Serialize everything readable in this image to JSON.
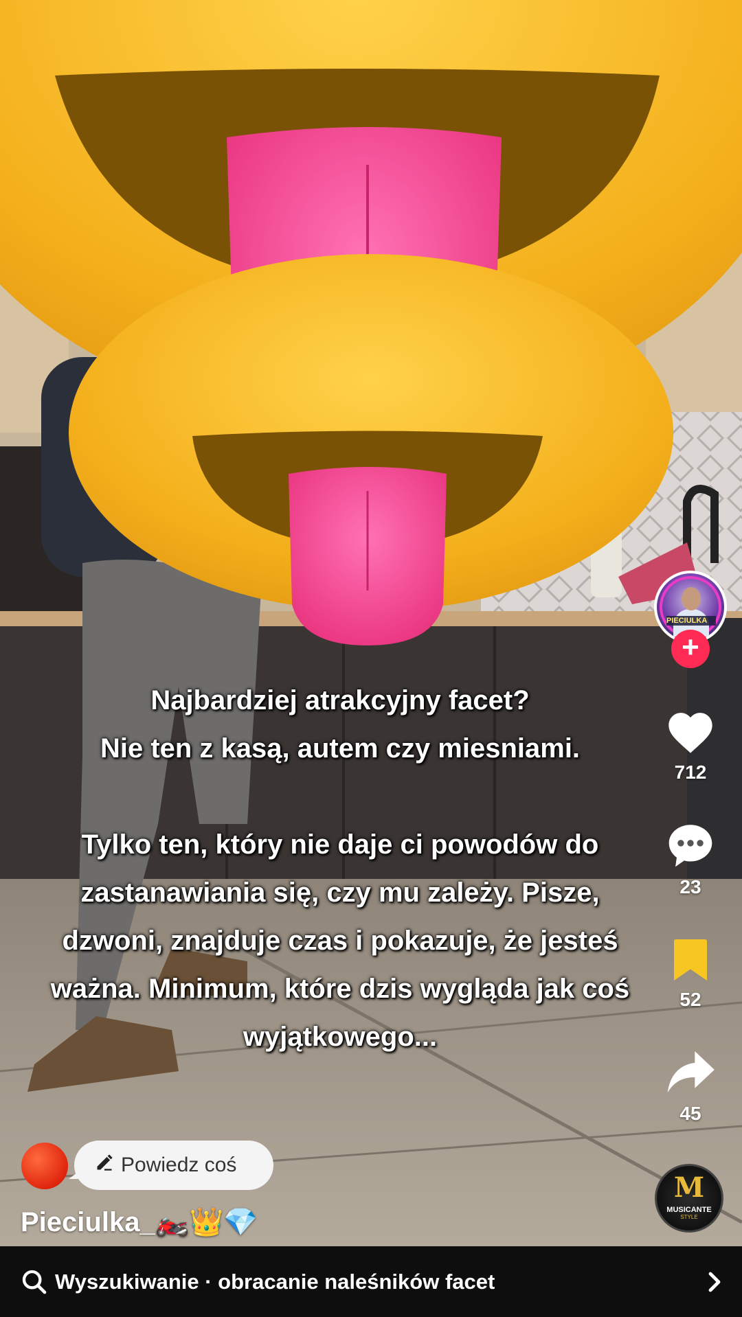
{
  "overlay_text": {
    "line1": "Najbardziej atrakcyjny facet?",
    "line2": "Nie ten z kasą, autem czy miesniami.",
    "line3": "Tylko ten, który nie daje ci powodów do",
    "line4": "zastanawiania się, czy mu zależy. Pisze,",
    "line5": "dzwoni, znajduje czas i pokazuje, że jesteś",
    "line6": "ważna. Minimum, które dzis wygląda jak coś",
    "line7": "wyjątkowego..."
  },
  "creator": {
    "avatar_plate_text": "PIECIULKA",
    "username": "Pieciulka_🏍️👑💎"
  },
  "actions": {
    "likes": "712",
    "comments": "23",
    "saves": "52",
    "shares": "45"
  },
  "comment_prompt": "Powiedz coś",
  "music": {
    "disc_letter": "M",
    "disc_label": "MUSICANTE",
    "disc_sublabel": "STYLE"
  },
  "search": {
    "text": "Wyszukiwanie · obracanie naleśników facet"
  },
  "colors": {
    "follow": "#ff2b54",
    "save_active": "#f7c623",
    "emoji_yellow": "#f4b81f",
    "tongue": "#f0488f"
  },
  "icons": [
    "heart-icon",
    "comment-icon",
    "bookmark-icon",
    "share-icon",
    "search-icon",
    "chevron-right-icon",
    "pencil-icon",
    "plus-icon"
  ]
}
